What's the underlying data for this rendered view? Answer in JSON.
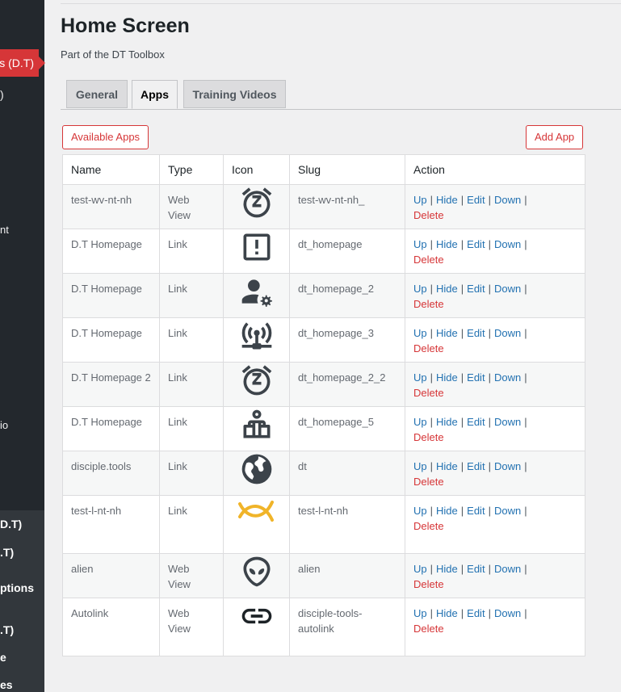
{
  "sidebar": {
    "items": [
      {
        "label": "s (D.T)",
        "top": 0
      },
      {
        "label": ")"
      },
      {
        "label": "nt"
      },
      {
        "label": "io"
      },
      {
        "label": "D.T)"
      },
      {
        "label": ".T)"
      },
      {
        "label": "ptions"
      },
      {
        "label": ".T)"
      },
      {
        "label": "e"
      },
      {
        "label": "es"
      }
    ]
  },
  "page": {
    "title": "Home Screen",
    "subtitle": "Part of the DT Toolbox"
  },
  "tabs": [
    {
      "label": "General"
    },
    {
      "label": "Apps"
    },
    {
      "label": "Training Videos"
    }
  ],
  "buttons": {
    "available_apps": "Available Apps",
    "add_app": "Add App"
  },
  "table": {
    "headers": [
      "Name",
      "Type",
      "Icon",
      "Slug",
      "Action"
    ],
    "actions": {
      "up": "Up",
      "hide": "Hide",
      "edit": "Edit",
      "down": "Down",
      "delete": "Delete"
    },
    "rows": [
      {
        "name": "test-wv-nt-nh",
        "type": "Web View",
        "icon": "snooze-alarm-icon",
        "slug": "test-wv-nt-nh_"
      },
      {
        "name": "D.T Homepage",
        "type": "Link",
        "icon": "alert-box-icon",
        "slug": "dt_homepage"
      },
      {
        "name": "D.T Homepage",
        "type": "Link",
        "icon": "user-cog-icon",
        "slug": "dt_homepage_2"
      },
      {
        "name": "D.T Homepage",
        "type": "Link",
        "icon": "access-point-network-icon",
        "slug": "dt_homepage_3"
      },
      {
        "name": "D.T Homepage 2",
        "type": "Link",
        "icon": "snooze-alarm-icon",
        "slug": "dt_homepage_2_2"
      },
      {
        "name": "D.T Homepage",
        "type": "Link",
        "icon": "person-podium-icon",
        "slug": "dt_homepage_5"
      },
      {
        "name": "disciple.tools",
        "type": "Link",
        "icon": "globe-icon",
        "slug": "dt"
      },
      {
        "name": "test-l-nt-nh",
        "type": "Link",
        "icon": "fish-icon",
        "slug": "test-l-nt-nh"
      },
      {
        "name": "alien",
        "type": "Web View",
        "icon": "alien-icon",
        "slug": "alien"
      },
      {
        "name": "Autolink",
        "type": "Web View",
        "icon": "link-icon",
        "slug": "disciple-tools-autolink"
      }
    ]
  },
  "colors": {
    "accent_red": "#d63638",
    "link_blue": "#2271b1",
    "fish_yellow": "#f0b429",
    "sidebar_dark": "#23282d"
  }
}
